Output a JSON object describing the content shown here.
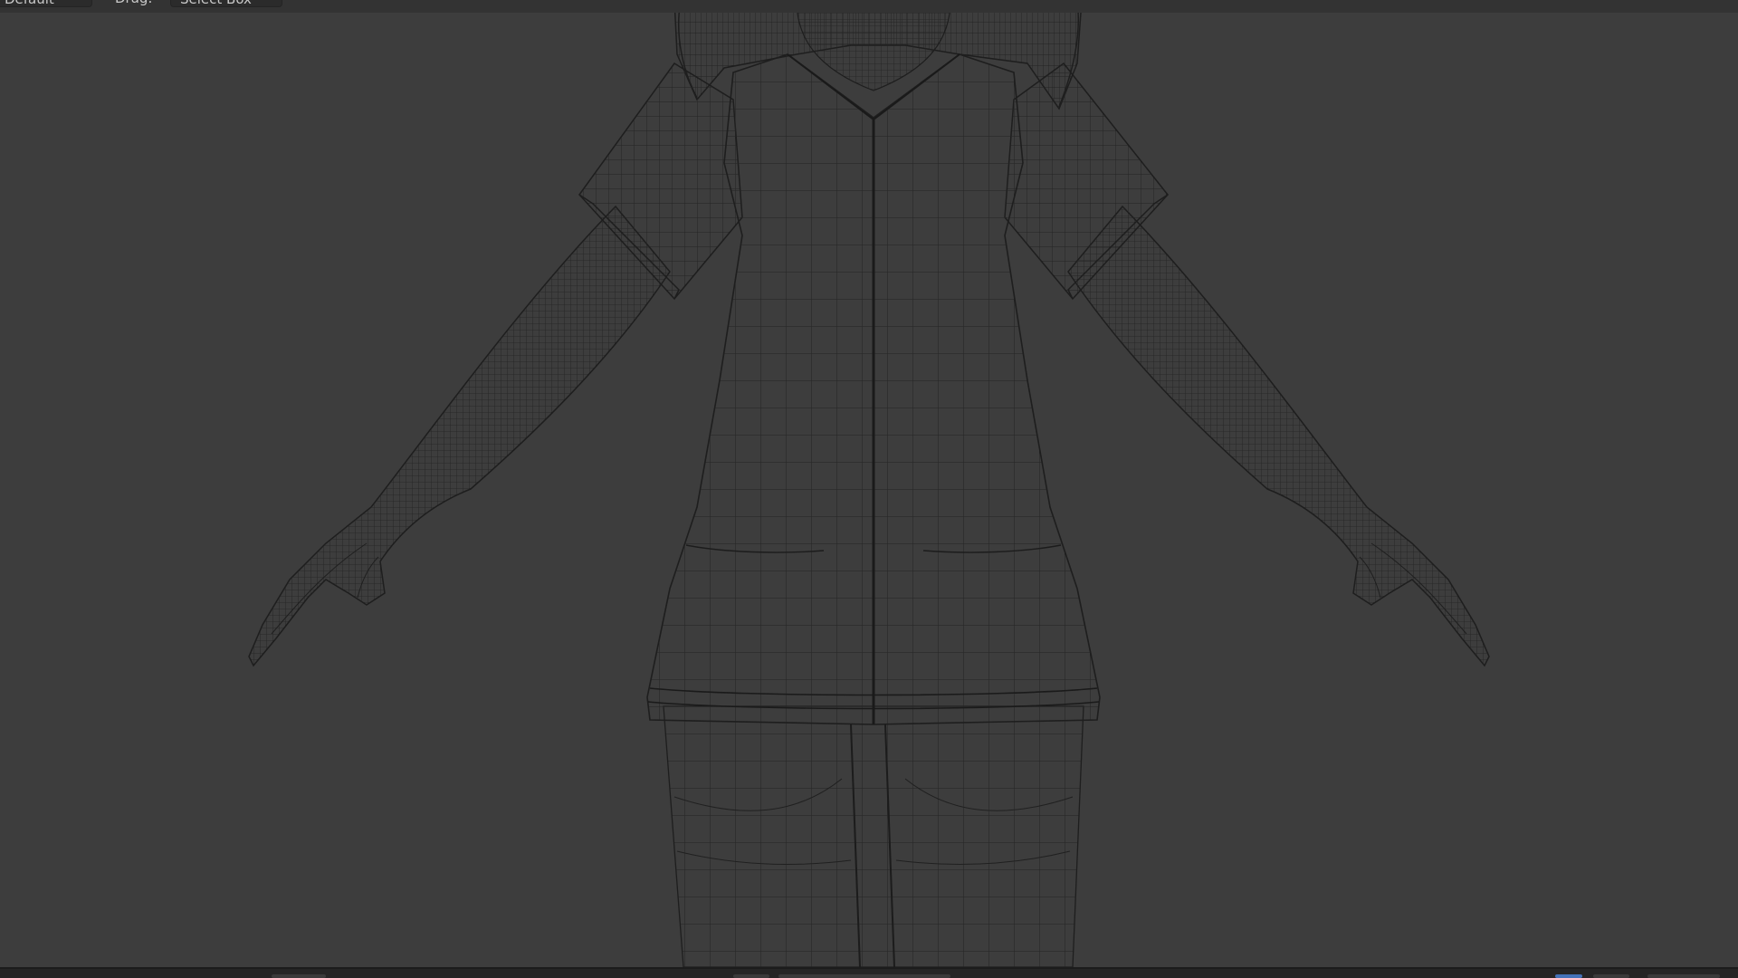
{
  "header": {
    "mode_select": "Default",
    "drag_label": "Drag:",
    "drag_select": "Select Box"
  },
  "viewport": {
    "shading": "wireframe",
    "background_color": "#3d3d3d",
    "wire_color": "#1e1e1e"
  },
  "statusbar": {
    "accent_color": "#4472b8"
  }
}
